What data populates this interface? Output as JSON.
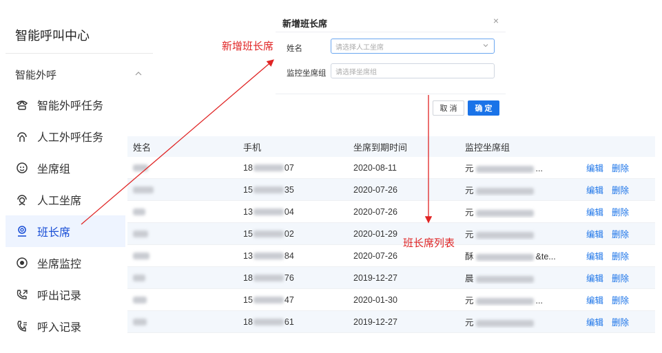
{
  "sidebar": {
    "title": "智能呼叫中心",
    "group": {
      "label": "智能外呼",
      "chevron": "chevron-up-icon"
    },
    "items": [
      {
        "label": "智能外呼任务",
        "icon": "phone-ring-icon"
      },
      {
        "label": "人工外呼任务",
        "icon": "headset-hand-icon"
      },
      {
        "label": "坐席组",
        "icon": "agent-group-icon"
      },
      {
        "label": "人工坐席",
        "icon": "agent-icon"
      },
      {
        "label": "班长席",
        "icon": "supervisor-icon",
        "active": true
      },
      {
        "label": "坐席监控",
        "icon": "monitor-eye-icon"
      },
      {
        "label": "呼出记录",
        "icon": "outgoing-call-icon"
      },
      {
        "label": "呼入记录",
        "icon": "incoming-call-icon"
      }
    ]
  },
  "table": {
    "headers": [
      "姓名",
      "手机",
      "坐席到期时间",
      "监控坐席组"
    ],
    "op_edit": "编辑",
    "op_delete": "删除",
    "rows": [
      {
        "phone_prefix": "18",
        "phone_suffix": "07",
        "date": "2020-08-11",
        "group_prefix": "元",
        "group_suffix": "..."
      },
      {
        "phone_prefix": "15",
        "phone_suffix": "35",
        "date": "2020-07-26",
        "group_prefix": "元",
        "group_suffix": ""
      },
      {
        "phone_prefix": "13",
        "phone_suffix": "04",
        "date": "2020-07-26",
        "group_prefix": "元",
        "group_suffix": ""
      },
      {
        "phone_prefix": "15",
        "phone_suffix": "02",
        "date": "2020-01-29",
        "group_prefix": "元",
        "group_suffix": ""
      },
      {
        "phone_prefix": "13",
        "phone_suffix": "84",
        "date": "2020-07-26",
        "group_prefix": "酥",
        "group_suffix": "&te..."
      },
      {
        "phone_prefix": "18",
        "phone_suffix": "76",
        "date": "2019-12-27",
        "group_prefix": "晨",
        "group_suffix": ""
      },
      {
        "phone_prefix": "15",
        "phone_suffix": "47",
        "date": "2020-01-30",
        "group_prefix": "元",
        "group_suffix": "..."
      },
      {
        "phone_prefix": "18",
        "phone_suffix": "61",
        "date": "2019-12-27",
        "group_prefix": "元",
        "group_suffix": ""
      }
    ]
  },
  "modal": {
    "title": "新增班长席",
    "close": "×",
    "name_label": "姓名",
    "name_placeholder": "请选择人工坐席",
    "group_label": "监控坐席组",
    "group_placeholder": "请选择坐席组",
    "cancel": "取 消",
    "ok": "确 定"
  },
  "annotations": {
    "add_label": "新增班长席",
    "list_label": "班长席列表",
    "color": "#e02424"
  },
  "colors": {
    "accent": "#1a73e8",
    "active_bg": "#eef4ff",
    "active_text": "#1a4fd6"
  }
}
